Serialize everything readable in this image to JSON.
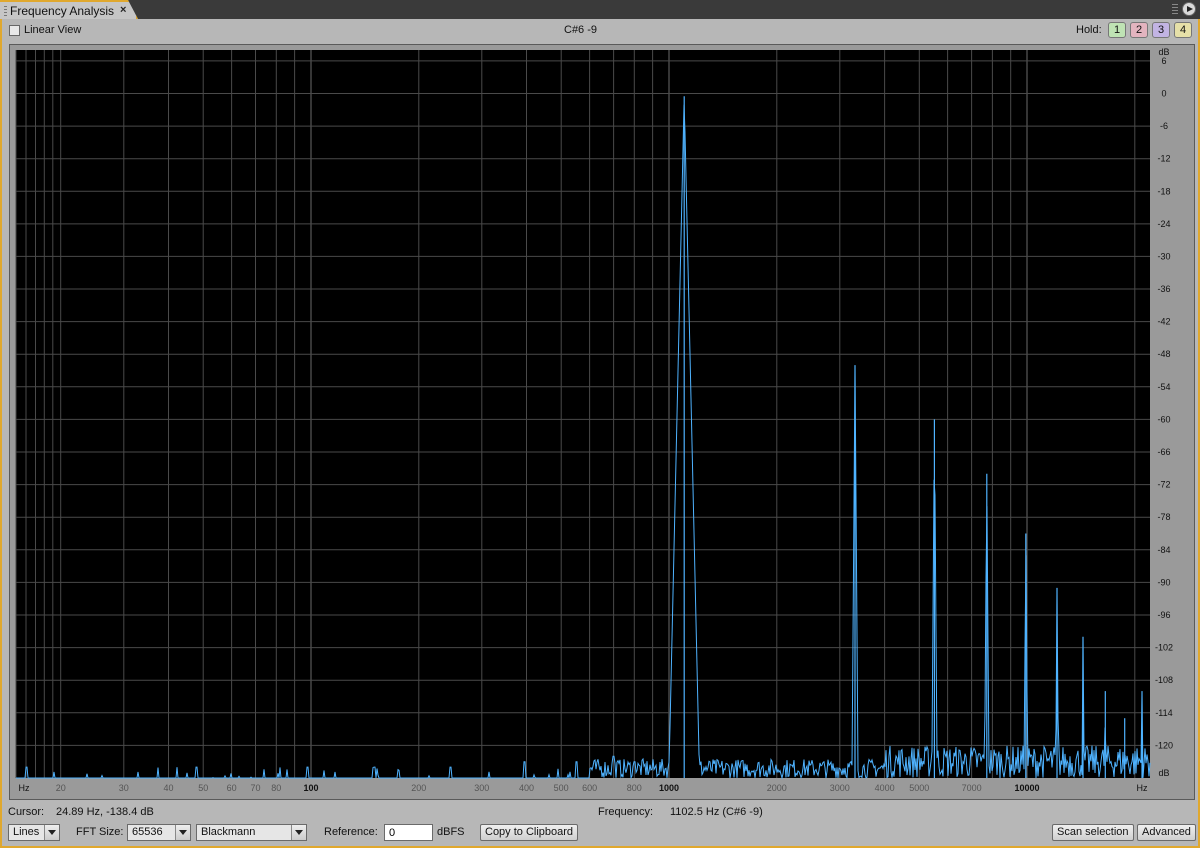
{
  "window": {
    "tab_title": "Frequency Analysis",
    "tab_close": "×",
    "note_display": "C#6 -9"
  },
  "toolbar": {
    "linear_view_label": "Linear View",
    "linear_view_checked": false,
    "hold_label": "Hold:",
    "hold_buttons": [
      {
        "label": "1",
        "color": "#bfe3b4"
      },
      {
        "label": "2",
        "color": "#e3b4bf"
      },
      {
        "label": "3",
        "color": "#c2b4e3"
      },
      {
        "label": "4",
        "color": "#e6e0a8"
      }
    ]
  },
  "status": {
    "cursor_label": "Cursor:",
    "cursor_value": "24.89 Hz, -138.4 dB",
    "frequency_label": "Frequency:",
    "frequency_value": "1102.5 Hz (C#6 -9)"
  },
  "controls": {
    "display_mode": "Lines",
    "fft_size_label": "FFT Size:",
    "fft_size": "65536",
    "window_function": "Blackmann",
    "reference_label": "Reference:",
    "reference_value": "0",
    "reference_unit": "dBFS",
    "copy_button": "Copy to Clipboard",
    "scan_button": "Scan selection",
    "advanced_button": "Advanced"
  },
  "colors": {
    "plot_background": "#000000",
    "grid": "#4a4a4a",
    "spectrum_line": "#4fb3ff",
    "panel_border": "#e0a82e"
  },
  "chart_data": {
    "type": "line",
    "x_scale": "log",
    "xlim": [
      15,
      22050
    ],
    "ylim": [
      -126,
      8
    ],
    "x_unit_label": "Hz",
    "y_unit_label": "dB",
    "x_tick_labels": [
      {
        "v": 20,
        "t": "20"
      },
      {
        "v": 30,
        "t": "30"
      },
      {
        "v": 40,
        "t": "40"
      },
      {
        "v": 50,
        "t": "50"
      },
      {
        "v": 60,
        "t": "60"
      },
      {
        "v": 70,
        "t": "70"
      },
      {
        "v": 80,
        "t": "80"
      },
      {
        "v": 100,
        "t": "100"
      },
      {
        "v": 200,
        "t": "200"
      },
      {
        "v": 300,
        "t": "300"
      },
      {
        "v": 400,
        "t": "400"
      },
      {
        "v": 500,
        "t": "500"
      },
      {
        "v": 600,
        "t": "600"
      },
      {
        "v": 800,
        "t": "800"
      },
      {
        "v": 1000,
        "t": "1000"
      },
      {
        "v": 2000,
        "t": "2000"
      },
      {
        "v": 3000,
        "t": "3000"
      },
      {
        "v": 4000,
        "t": "4000"
      },
      {
        "v": 5000,
        "t": "5000"
      },
      {
        "v": 7000,
        "t": "7000"
      },
      {
        "v": 10000,
        "t": "10000"
      }
    ],
    "x_minor_grid": [
      15,
      16,
      17,
      18,
      19,
      20,
      30,
      40,
      50,
      60,
      70,
      80,
      90,
      100,
      200,
      300,
      400,
      500,
      600,
      700,
      800,
      900,
      1000,
      2000,
      3000,
      4000,
      5000,
      6000,
      7000,
      8000,
      9000,
      10000,
      20000
    ],
    "y_ticks": [
      6,
      0,
      -6,
      -12,
      -18,
      -24,
      -30,
      -36,
      -42,
      -48,
      -54,
      -60,
      -66,
      -72,
      -78,
      -84,
      -90,
      -96,
      -102,
      -108,
      -114,
      -120
    ],
    "noise_floor_db": -126,
    "peaks": [
      {
        "freq": 1102.5,
        "db": -0.5
      },
      {
        "freq": 3307.5,
        "db": -50
      },
      {
        "freq": 5512.5,
        "db": -60
      },
      {
        "freq": 7717.5,
        "db": -70
      },
      {
        "freq": 9922.5,
        "db": -81
      },
      {
        "freq": 12127.5,
        "db": -91
      },
      {
        "freq": 14332.5,
        "db": -100
      },
      {
        "freq": 16537.5,
        "db": -110
      },
      {
        "freq": 18742.5,
        "db": -115
      },
      {
        "freq": 20947.5,
        "db": -110
      }
    ],
    "low_spurs": [
      {
        "freq": 16,
        "db": -124
      },
      {
        "freq": 48,
        "db": -124
      },
      {
        "freq": 98,
        "db": -124
      },
      {
        "freq": 150,
        "db": -124
      },
      {
        "freq": 245,
        "db": -124
      },
      {
        "freq": 395,
        "db": -123
      },
      {
        "freq": 550,
        "db": -123
      },
      {
        "freq": 700,
        "db": -122
      },
      {
        "freq": 800,
        "db": -123
      }
    ]
  }
}
